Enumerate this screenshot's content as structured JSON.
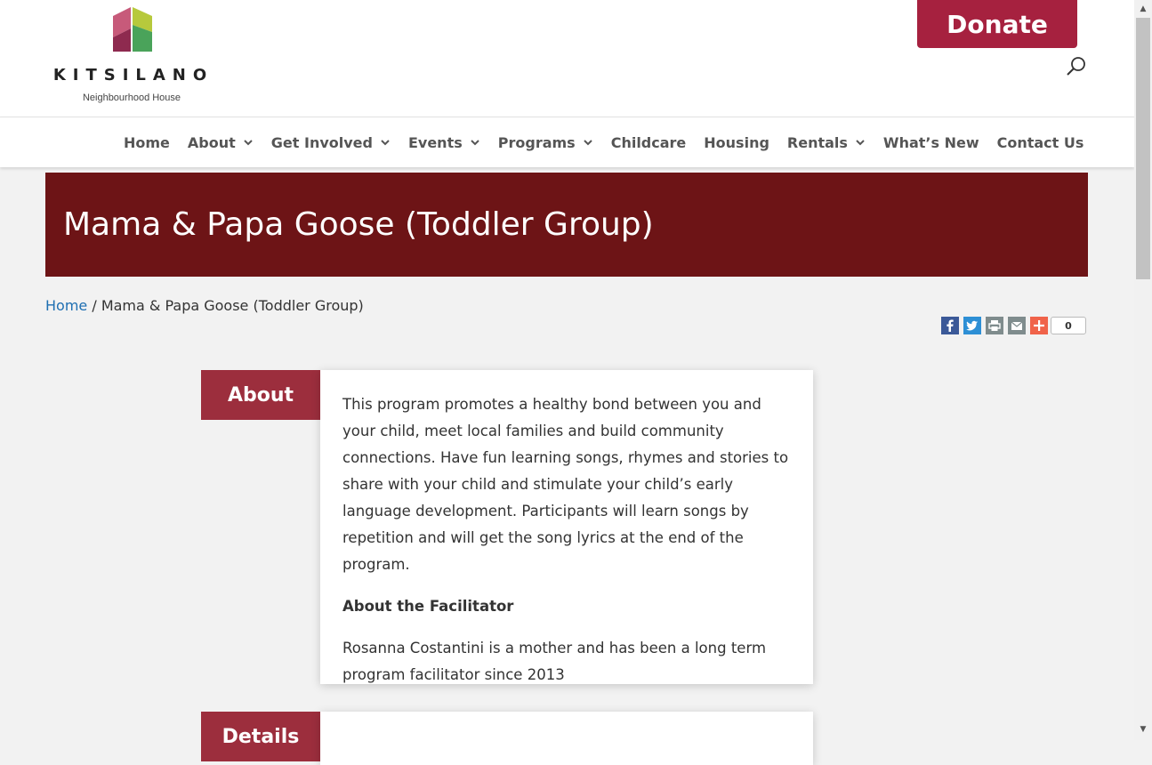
{
  "header": {
    "logo_name": "KITSILANO",
    "logo_sub": "Neighbourhood House",
    "donate_label": "Donate"
  },
  "nav": {
    "items": [
      {
        "label": "Home",
        "dropdown": false
      },
      {
        "label": "About",
        "dropdown": true
      },
      {
        "label": "Get Involved",
        "dropdown": true
      },
      {
        "label": "Events",
        "dropdown": true
      },
      {
        "label": "Programs",
        "dropdown": true
      },
      {
        "label": "Childcare",
        "dropdown": false
      },
      {
        "label": "Housing",
        "dropdown": false
      },
      {
        "label": "Rentals",
        "dropdown": true
      },
      {
        "label": "What’s New",
        "dropdown": false
      },
      {
        "label": "Contact Us",
        "dropdown": false
      }
    ]
  },
  "page": {
    "title": "Mama & Papa Goose (Toddler Group)"
  },
  "breadcrumb": {
    "home": "Home",
    "separator": " / ",
    "current": "Mama & Papa Goose (Toddler Group)"
  },
  "share": {
    "icons": [
      "facebook-icon",
      "twitter-icon",
      "print-icon",
      "email-icon",
      "plus-icon"
    ],
    "count": "0"
  },
  "about": {
    "tab_label": "About",
    "paragraph": "This program promotes a healthy bond between you and your child, meet local families and build community connections. Have fun learning songs, rhymes and stories to share with your child and stimulate your child’s early language development. Participants will learn songs by repetition and will get the song lyrics at the end of the program.",
    "facilitator_heading": "About the Facilitator",
    "facilitator_text": "Rosanna Costantini is a mother and has been a long term program facilitator since 2013"
  },
  "details": {
    "tab_label": "Details"
  },
  "colors": {
    "brand": "#a6213f",
    "banner": "#6d1416",
    "tab": "#9c2e3d",
    "link": "#1f6fb2"
  }
}
